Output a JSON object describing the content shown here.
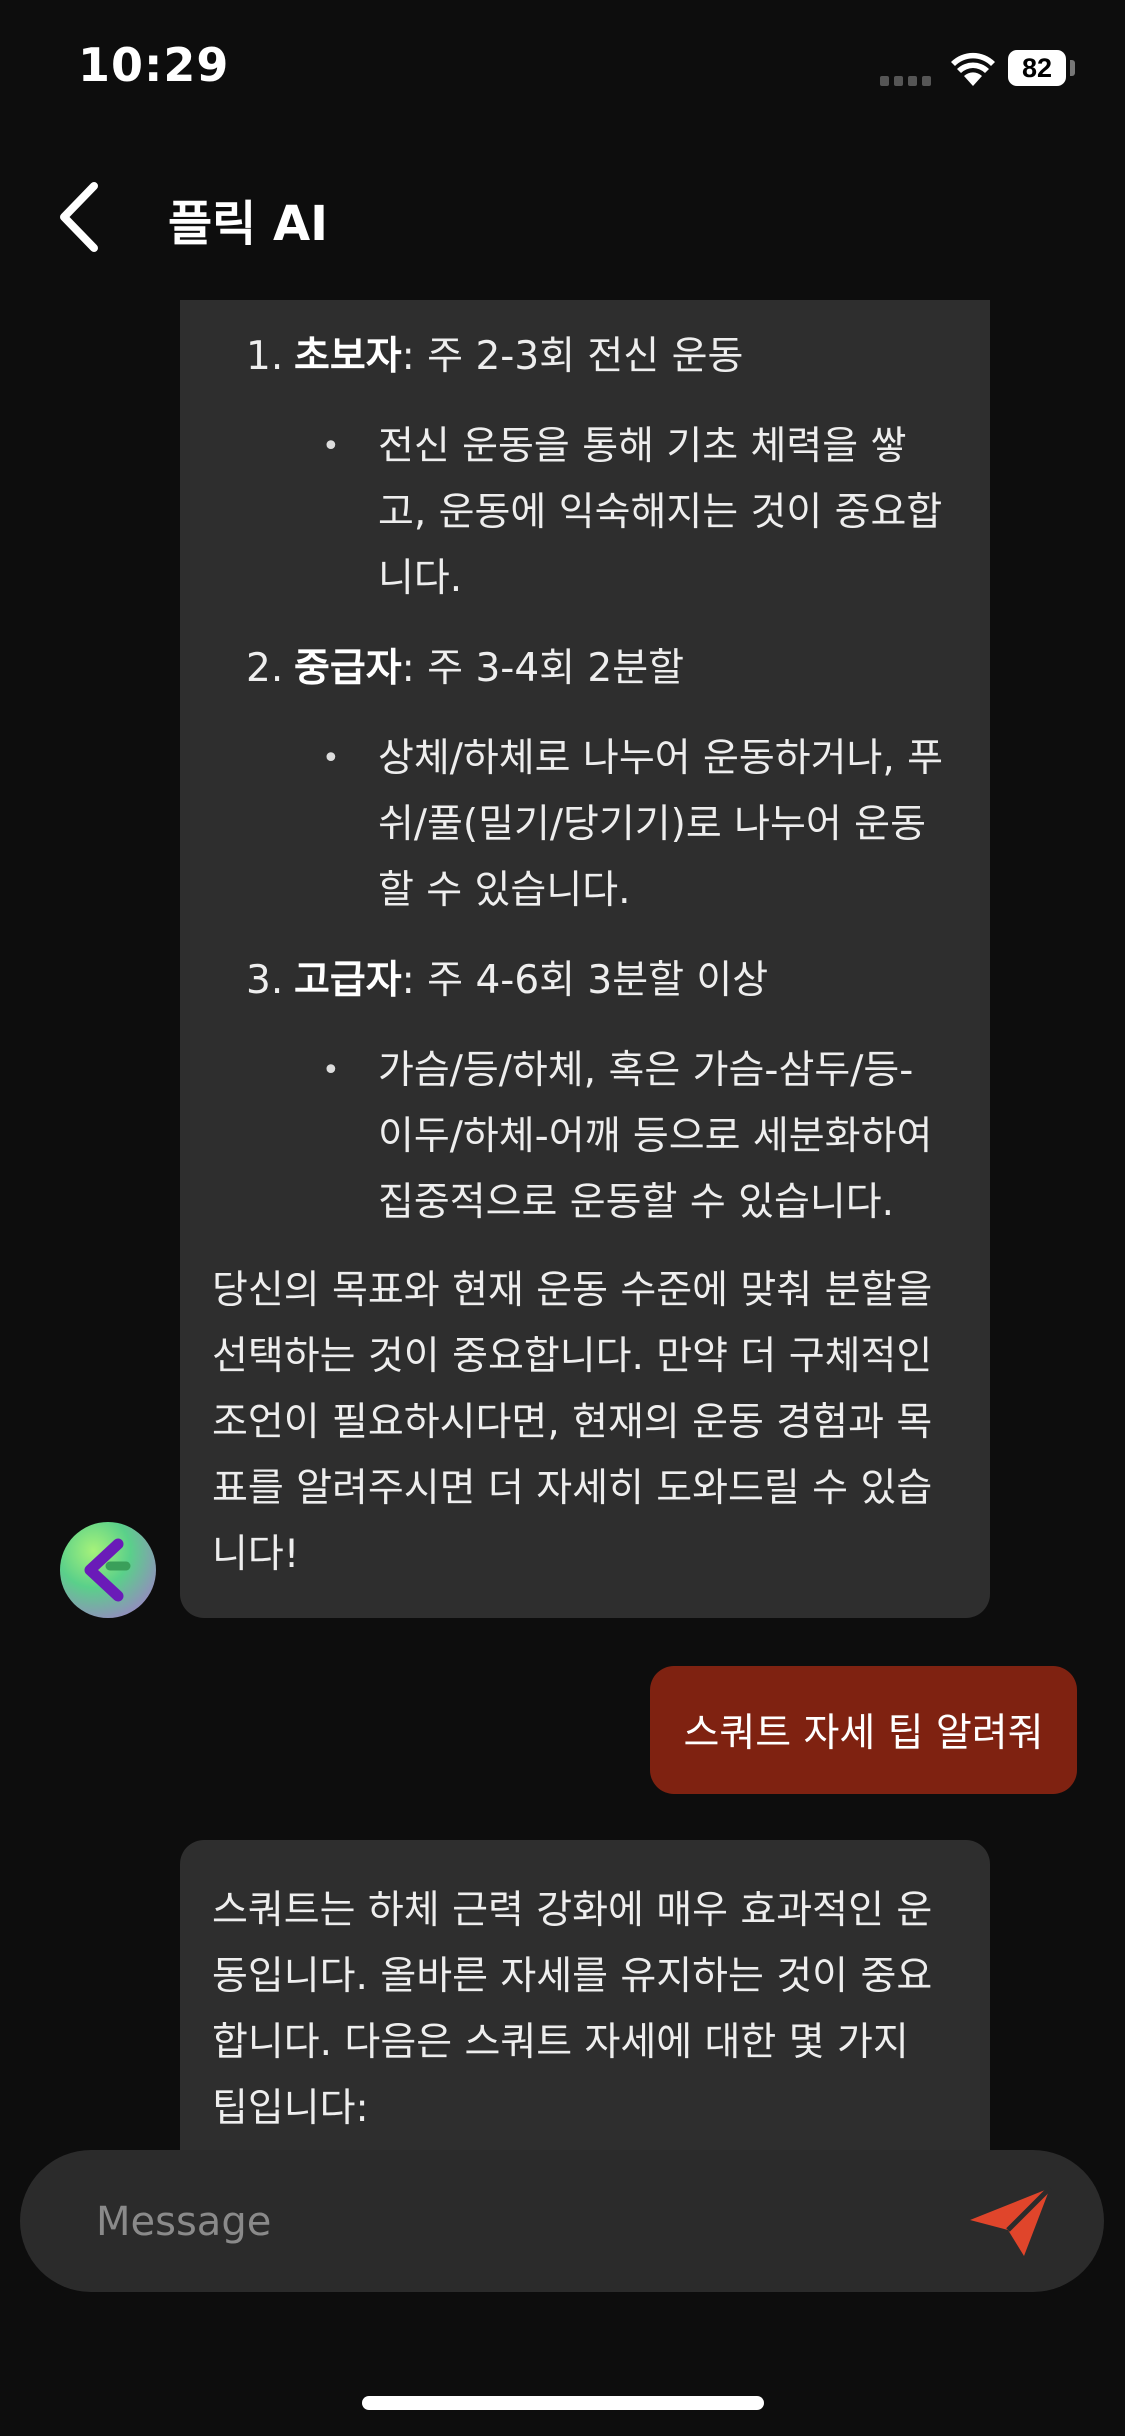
{
  "status": {
    "time": "10:29",
    "battery": "82"
  },
  "header": {
    "title": "플릭 AI"
  },
  "messages": {
    "ai1": {
      "items": [
        {
          "num": "1.",
          "bold": "초보자",
          "rest": ": 주 2-3회 전신 운동",
          "bullet": [
            "전신 운동을 통해 기초 체력을 쌓",
            "고, 운동에 익숙해지는 것이 중요합",
            "니다."
          ]
        },
        {
          "num": "2.",
          "bold": "중급자",
          "rest": ": 주 3-4회 2분할",
          "bullet": [
            "상체/하체로 나누어 운동하거나, 푸",
            "쉬/풀(밀기/당기기)로 나누어 운동",
            "할 수 있습니다."
          ]
        },
        {
          "num": "3.",
          "bold": "고급자",
          "rest": ": 주 4-6회 3분할 이상",
          "bullet": [
            "가슴/등/하체, 혹은 가슴-삼두/등-",
            "이두/하체-어깨 등으로 세분화하여",
            "집중적으로 운동할 수 있습니다."
          ]
        }
      ],
      "closing": [
        "당신의 목표와 현재 운동 수준에 맞춰 분할을",
        "선택하는 것이 중요합니다. 만약 더 구체적인",
        "조언이 필요하시다면, 현재의 운동 경험과 목",
        "표를 알려주시면 더 자세히 도와드릴 수 있습",
        "니다!"
      ]
    },
    "user1": "스쿼트 자세 팁 알려줘",
    "ai2": [
      "스쿼트는 하체 근력 강화에 매우 효과적인 운",
      "동입니다. 올바른 자세를 유지하는 것이 중요",
      "합니다. 다음은 스쿼트 자세에 대한 몇 가지",
      "팁입니다:"
    ]
  },
  "input": {
    "placeholder": "Message"
  },
  "icons": {
    "back": "chevron-left-icon",
    "send": "paper-plane-icon",
    "wifi": "wifi-icon",
    "battery": "battery-icon"
  },
  "colors": {
    "background": "#0d0d0d",
    "ai_bubble": "#2e2e2e",
    "user_bubble": "#7f2211",
    "send": "#e0452b"
  }
}
